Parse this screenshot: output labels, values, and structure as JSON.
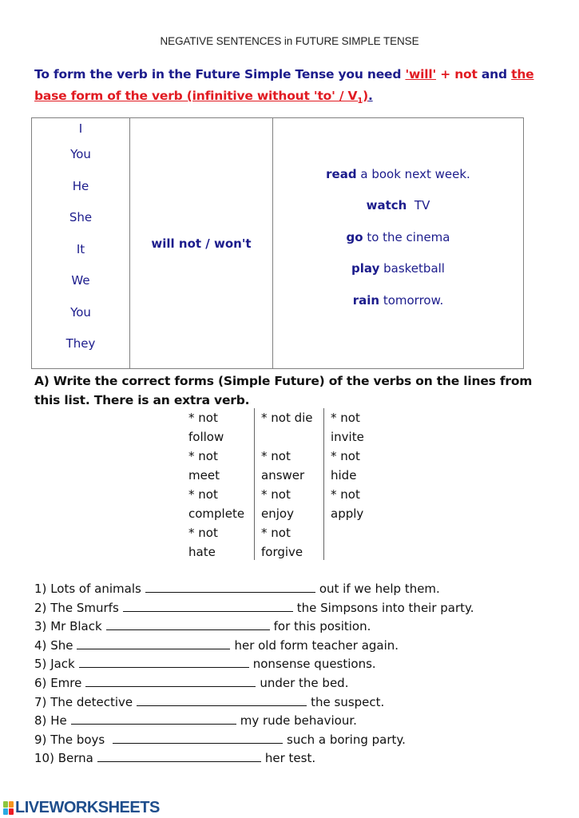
{
  "document": {
    "title": "NEGATIVE SENTENCES in FUTURE SIMPLE TENSE",
    "intro": {
      "part1": "To form the verb in the Future Simple Tense you need ",
      "will": "'will'",
      "plus_not": " + not",
      "and": " and ",
      "the": "the",
      "line2": "base form of the verb (infinitive without 'to' / V",
      "sub": "1",
      "close": ")",
      "period": "."
    },
    "grammar_table": {
      "pronouns": [
        "I",
        "You",
        "He",
        "She",
        "It",
        "We",
        "You",
        "They"
      ],
      "auxiliary": "will not / won't",
      "phrases": [
        {
          "verb": "read",
          "rest": " a book next week."
        },
        {
          "verb": "watch",
          "rest": "  TV"
        },
        {
          "verb": "go",
          "rest": " to the cinema"
        },
        {
          "verb": "play",
          "rest": " basketball"
        },
        {
          "verb": "rain",
          "rest": " tomorrow."
        }
      ]
    },
    "task_a": {
      "instruction": "A) Write the correct forms (Simple Future) of the verbs on the lines from this list. There is an extra verb."
    },
    "verb_list": {
      "columns": [
        [
          "* not",
          "follow",
          "* not",
          "meet",
          "* not",
          "complete",
          "* not",
          "hate"
        ],
        [
          "* not die",
          "",
          "* not",
          "answer",
          "* not",
          "enjoy",
          "* not",
          "forgive"
        ],
        [
          "* not",
          "invite",
          "* not",
          "hide",
          "* not",
          "apply"
        ]
      ]
    },
    "exercises": [
      {
        "num": "1)",
        "before": "Lots of animals",
        "after": "out if we help them."
      },
      {
        "num": "2)",
        "before": "The Smurfs",
        "after": "the Simpsons into their party."
      },
      {
        "num": "3)",
        "before": "Mr Black",
        "after": "for this position."
      },
      {
        "num": "4)",
        "before": "She",
        "after": "her old form teacher again."
      },
      {
        "num": "5)",
        "before": "Jack",
        "after": "nonsense questions."
      },
      {
        "num": "6)",
        "before": "Emre",
        "after": "under the bed."
      },
      {
        "num": "7)",
        "before": "The detective",
        "after": "the suspect."
      },
      {
        "num": "8)",
        "before": "He",
        "after": "my rude behaviour."
      },
      {
        "num": "9)",
        "before": "The boys ",
        "after": "such a boring party."
      },
      {
        "num": "10)",
        "before": "Berna",
        "after": "her test."
      }
    ]
  },
  "footer": {
    "brand": "LIVEWORKSHEETS",
    "logo_letters": [
      "L",
      "I",
      "V",
      "E"
    ],
    "logo_colors": [
      "#8dc63f",
      "#f7941d",
      "#29abe2",
      "#ed1c24"
    ]
  },
  "colors": {
    "navy": "#1c1c8c",
    "red": "#e11b22",
    "brand": "#1f4e8c"
  }
}
